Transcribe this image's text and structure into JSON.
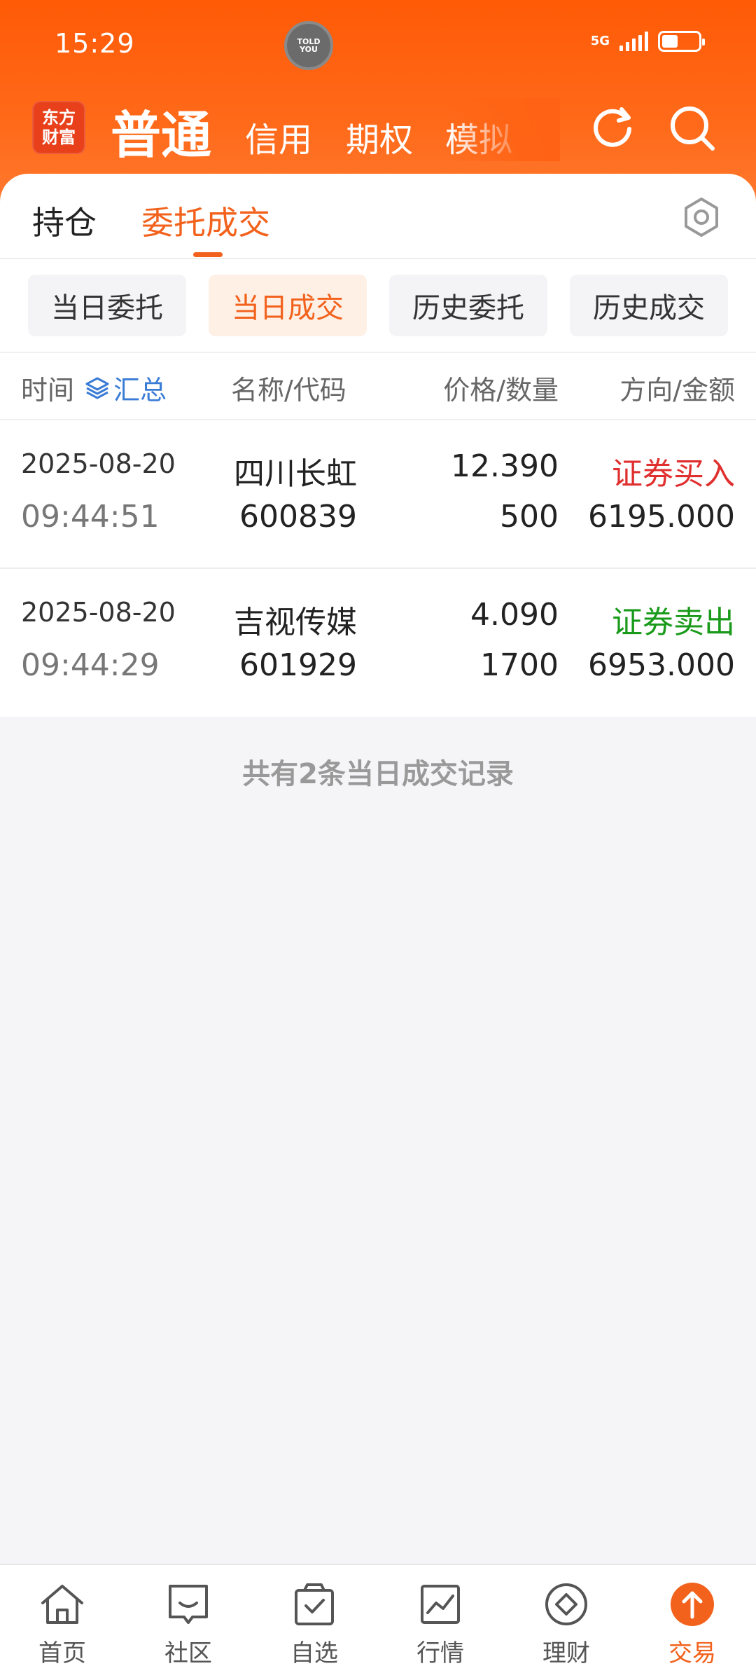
{
  "status_bar": {
    "time": "15:29",
    "center_badge": "TOLD YOU",
    "network": "5G"
  },
  "top_nav": {
    "logo_line1": "东方",
    "logo_line2": "财富",
    "main": "普通",
    "items": [
      "信用",
      "期权",
      "模拟"
    ]
  },
  "sub_tabs": {
    "hold": "持仓",
    "order": "委托成交"
  },
  "segments": [
    "当日委托",
    "当日成交",
    "历史委托",
    "历史成交"
  ],
  "active_segment": "当日成交",
  "table": {
    "headers": {
      "time": "时间",
      "summary": "汇总",
      "name_code": "名称/代码",
      "price_qty": "价格/数量",
      "dir_amt": "方向/金额"
    },
    "rows": [
      {
        "date": "2025-08-20",
        "time": "09:44:51",
        "name": "四川长虹",
        "code": "600839",
        "price": "12.390",
        "qty": "500",
        "direction": "证券买入",
        "amount": "6195.000"
      },
      {
        "date": "2025-08-20",
        "time": "09:44:29",
        "name": "吉视传媒",
        "code": "601929",
        "price": "4.090",
        "qty": "1700",
        "direction": "证券卖出",
        "amount": "6953.000"
      }
    ]
  },
  "footer_note": "共有2条当日成交记录",
  "tabbar": [
    {
      "label": "首页",
      "icon": "home-icon"
    },
    {
      "label": "社区",
      "icon": "chat-icon"
    },
    {
      "label": "自选",
      "icon": "bag-check-icon"
    },
    {
      "label": "行情",
      "icon": "chart-icon"
    },
    {
      "label": "理财",
      "icon": "diamond-icon"
    },
    {
      "label": "交易",
      "icon": "trade-arrow-icon"
    }
  ],
  "colors": {
    "brand": "#ff5a06",
    "accent": "#f2621c",
    "buy": "#e02f2f",
    "sell": "#1a9a1a",
    "link": "#3a7bd5"
  }
}
